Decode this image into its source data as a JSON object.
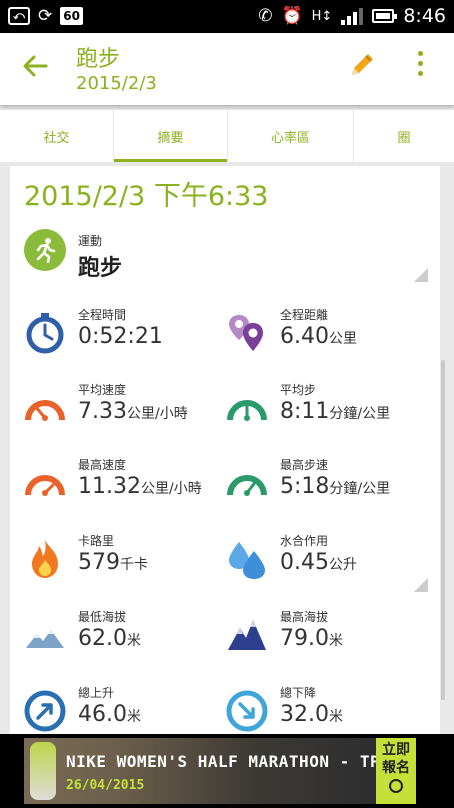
{
  "status_bar": {
    "sim_badge": "60",
    "time": "8:46"
  },
  "header": {
    "title": "跑步",
    "subtitle": "2015/2/3"
  },
  "tabs": [
    {
      "label": "社交"
    },
    {
      "label": "摘要",
      "active": true
    },
    {
      "label": "心率區"
    },
    {
      "label": "圈"
    }
  ],
  "summary": {
    "datetime": "2015/2/3 下午6:33",
    "sport": {
      "label": "運動",
      "value": "跑步"
    },
    "stats": {
      "duration": {
        "label": "全程時間",
        "value": "0:52:21",
        "unit": ""
      },
      "distance": {
        "label": "全程距離",
        "value": "6.40",
        "unit": "公里"
      },
      "avg_speed": {
        "label": "平均速度",
        "value": "7.33",
        "unit": "公里/小時"
      },
      "avg_pace": {
        "label": "平均步",
        "value": "8:11",
        "unit": "分鐘/公里"
      },
      "max_speed": {
        "label": "最高速度",
        "value": "11.32",
        "unit": "公里/小時"
      },
      "max_pace": {
        "label": "最高步速",
        "value": "5:18",
        "unit": "分鐘/公里"
      },
      "calories": {
        "label": "卡路里",
        "value": "579",
        "unit": "千卡"
      },
      "hydration": {
        "label": "水合作用",
        "value": "0.45",
        "unit": "公升"
      },
      "min_alt": {
        "label": "最低海拔",
        "value": "62.0",
        "unit": "米"
      },
      "max_alt": {
        "label": "最高海拔",
        "value": "79.0",
        "unit": "米"
      },
      "ascent": {
        "label": "總上升",
        "value": "46.0",
        "unit": "米"
      },
      "descent": {
        "label": "總下降",
        "value": "32.0",
        "unit": "米"
      }
    }
  },
  "ad": {
    "title": "NIKE WOMEN'S HALF MARATHON - TPE",
    "date": "26/04/2015",
    "button_line1": "立即",
    "button_line2": "報名"
  },
  "colors": {
    "accent": "#8ab21e",
    "blue": "#2f5fa8",
    "orange": "#e8622a",
    "teal": "#2a9a6a",
    "purple": "#7a3f98",
    "lightblue": "#3fa5d8"
  }
}
